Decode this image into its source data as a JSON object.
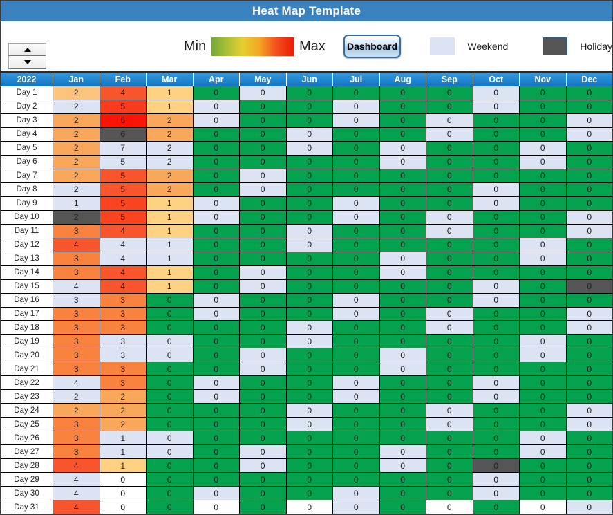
{
  "title": "Heat Map Template",
  "toolbar": {
    "spinner_up": "▲",
    "spinner_down": "▼",
    "min_label": "Min",
    "max_label": "Max",
    "dashboard_label": "Dashboard",
    "weekend_label": "Weekend",
    "holiday_label": "Holiday",
    "gradient_colors": [
      "#74a73a",
      "#e4cf2f",
      "#f5a623",
      "#ee1b05"
    ],
    "weekend_color": "#dce3f2",
    "holiday_color": "#555555",
    "accent_color": "#3a81c0"
  },
  "grid": {
    "corner_label": "2022",
    "months": [
      "Jan",
      "Feb",
      "Mar",
      "Apr",
      "May",
      "Jun",
      "Jul",
      "Aug",
      "Sep",
      "Oct",
      "Nov",
      "Dec"
    ],
    "day_labels": [
      "Day 1",
      "Day 2",
      "Day 3",
      "Day 4",
      "Day 5",
      "Day 6",
      "Day 7",
      "Day 8",
      "Day 9",
      "Day 10",
      "Day 11",
      "Day 12",
      "Day 13",
      "Day 14",
      "Day 15",
      "Day 16",
      "Day 17",
      "Day 18",
      "Day 19",
      "Day 20",
      "Day 21",
      "Day 22",
      "Day 23",
      "Day 24",
      "Day 25",
      "Day 26",
      "Day 27",
      "Day 28",
      "Day 29",
      "Day 30",
      "Day 31"
    ]
  },
  "chart_data": {
    "type": "heatmap",
    "title": "Heat Map Template",
    "xlabel": "",
    "ylabel": "",
    "x_categories": [
      "Jan",
      "Feb",
      "Mar",
      "Apr",
      "May",
      "Jun",
      "Jul",
      "Aug",
      "Sep",
      "Oct",
      "Nov",
      "Dec"
    ],
    "y_categories": [
      "Day 1",
      "Day 2",
      "Day 3",
      "Day 4",
      "Day 5",
      "Day 6",
      "Day 7",
      "Day 8",
      "Day 9",
      "Day 10",
      "Day 11",
      "Day 12",
      "Day 13",
      "Day 14",
      "Day 15",
      "Day 16",
      "Day 17",
      "Day 18",
      "Day 19",
      "Day 20",
      "Day 21",
      "Day 22",
      "Day 23",
      "Day 24",
      "Day 25",
      "Day 26",
      "Day 27",
      "Day 28",
      "Day 29",
      "Day 30",
      "Day 31"
    ],
    "legend": [
      {
        "label": "Min",
        "color": "#74a73a"
      },
      {
        "label": "Max",
        "color": "#ee1b05"
      },
      {
        "label": "Weekend",
        "color": "#dce3f2"
      },
      {
        "label": "Holiday",
        "color": "#555555"
      }
    ],
    "colorscale": [
      "#74a73a",
      "#e4cf2f",
      "#f5a623",
      "#ee1b05"
    ],
    "values": [
      [
        2,
        4,
        1,
        0,
        0,
        0,
        0,
        0,
        0,
        0,
        0,
        0
      ],
      [
        2,
        5,
        1,
        0,
        0,
        0,
        0,
        0,
        0,
        0,
        0,
        0
      ],
      [
        2,
        6,
        2,
        0,
        0,
        0,
        0,
        0,
        0,
        0,
        0,
        0
      ],
      [
        2,
        6,
        2,
        0,
        0,
        0,
        0,
        0,
        0,
        0,
        0,
        0
      ],
      [
        2,
        7,
        2,
        0,
        0,
        0,
        0,
        0,
        0,
        0,
        0,
        0
      ],
      [
        2,
        5,
        2,
        0,
        0,
        0,
        0,
        0,
        0,
        0,
        0,
        0
      ],
      [
        2,
        5,
        2,
        0,
        0,
        0,
        0,
        0,
        0,
        0,
        0,
        0
      ],
      [
        2,
        5,
        2,
        0,
        0,
        0,
        0,
        0,
        0,
        0,
        0,
        0
      ],
      [
        1,
        5,
        1,
        0,
        0,
        0,
        0,
        0,
        0,
        0,
        0,
        0
      ],
      [
        2,
        5,
        1,
        0,
        0,
        0,
        0,
        0,
        0,
        0,
        0,
        0
      ],
      [
        3,
        4,
        1,
        0,
        0,
        0,
        0,
        0,
        0,
        0,
        0,
        0
      ],
      [
        4,
        4,
        1,
        0,
        0,
        0,
        0,
        0,
        0,
        0,
        0,
        0
      ],
      [
        3,
        4,
        1,
        0,
        0,
        0,
        0,
        0,
        0,
        0,
        0,
        0
      ],
      [
        3,
        4,
        1,
        0,
        0,
        0,
        0,
        0,
        0,
        0,
        0,
        0
      ],
      [
        4,
        4,
        1,
        0,
        0,
        0,
        0,
        0,
        0,
        0,
        0,
        0
      ],
      [
        3,
        3,
        0,
        0,
        0,
        0,
        0,
        0,
        0,
        0,
        0,
        0
      ],
      [
        3,
        3,
        0,
        0,
        0,
        0,
        0,
        0,
        0,
        0,
        0,
        0
      ],
      [
        3,
        3,
        0,
        0,
        0,
        0,
        0,
        0,
        0,
        0,
        0,
        0
      ],
      [
        3,
        3,
        0,
        0,
        0,
        0,
        0,
        0,
        0,
        0,
        0,
        0
      ],
      [
        3,
        3,
        0,
        0,
        0,
        0,
        0,
        0,
        0,
        0,
        0,
        0
      ],
      [
        3,
        3,
        0,
        0,
        0,
        0,
        0,
        0,
        0,
        0,
        0,
        0
      ],
      [
        4,
        3,
        0,
        0,
        0,
        0,
        0,
        0,
        0,
        0,
        0,
        0
      ],
      [
        2,
        2,
        0,
        0,
        0,
        0,
        0,
        0,
        0,
        0,
        0,
        0
      ],
      [
        2,
        2,
        0,
        0,
        0,
        0,
        0,
        0,
        0,
        0,
        0,
        0
      ],
      [
        3,
        2,
        0,
        0,
        0,
        0,
        0,
        0,
        0,
        0,
        0,
        0
      ],
      [
        3,
        1,
        0,
        0,
        0,
        0,
        0,
        0,
        0,
        0,
        0,
        0
      ],
      [
        3,
        1,
        0,
        0,
        0,
        0,
        0,
        0,
        0,
        0,
        0,
        0
      ],
      [
        4,
        1,
        0,
        0,
        0,
        0,
        0,
        0,
        0,
        0,
        0,
        0
      ],
      [
        4,
        0,
        0,
        0,
        0,
        0,
        0,
        0,
        0,
        0,
        0,
        0
      ],
      [
        4,
        0,
        0,
        0,
        0,
        0,
        0,
        0,
        0,
        0,
        0,
        0
      ],
      [
        4,
        0,
        0,
        0,
        0,
        0,
        0,
        0,
        0,
        0,
        0,
        0
      ]
    ],
    "cell_fills": [
      [
        "#fbc37c",
        "#f9552d",
        "#ffd182",
        "#04a14e",
        "#dce3f2",
        "#04a14e",
        "#04a14e",
        "#04a14e",
        "#04a14e",
        "#dce3f2",
        "#04a14e",
        "#04a14e"
      ],
      [
        "#dce3f2",
        "#f93b20",
        "#ffd182",
        "#dce3f2",
        "#04a14e",
        "#04a14e",
        "#dce3f2",
        "#04a14e",
        "#04a14e",
        "#dce3f2",
        "#04a14e",
        "#04a14e"
      ],
      [
        "#f9a85b",
        "#fa1406",
        "#f9a85b",
        "#dce3f2",
        "#04a14e",
        "#04a14e",
        "#dce3f2",
        "#04a14e",
        "#dce3f2",
        "#04a14e",
        "#04a14e",
        "#dce3f2"
      ],
      [
        "#f9a85b",
        "#555555",
        "#f9a85b",
        "#04a14e",
        "#04a14e",
        "#dce3f2",
        "#04a14e",
        "#04a14e",
        "#dce3f2",
        "#04a14e",
        "#04a14e",
        "#dce3f2"
      ],
      [
        "#f9a85b",
        "#dce3f2",
        "#dce3f2",
        "#04a14e",
        "#04a14e",
        "#dce3f2",
        "#04a14e",
        "#dce3f2",
        "#04a14e",
        "#04a14e",
        "#dce3f2",
        "#04a14e"
      ],
      [
        "#f9a85b",
        "#dce3f2",
        "#dce3f2",
        "#04a14e",
        "#04a14e",
        "#04a14e",
        "#04a14e",
        "#dce3f2",
        "#04a14e",
        "#04a14e",
        "#dce3f2",
        "#04a14e"
      ],
      [
        "#f9a85b",
        "#f9552d",
        "#f9a85b",
        "#04a14e",
        "#dce3f2",
        "#04a14e",
        "#04a14e",
        "#04a14e",
        "#04a14e",
        "#04a14e",
        "#04a14e",
        "#04a14e"
      ],
      [
        "#dce3f2",
        "#f9552d",
        "#f9a85b",
        "#04a14e",
        "#dce3f2",
        "#04a14e",
        "#04a14e",
        "#04a14e",
        "#04a14e",
        "#dce3f2",
        "#04a14e",
        "#04a14e"
      ],
      [
        "#dce3f2",
        "#f9441f",
        "#ffd182",
        "#dce3f2",
        "#04a14e",
        "#04a14e",
        "#dce3f2",
        "#04a14e",
        "#04a14e",
        "#dce3f2",
        "#04a14e",
        "#04a14e"
      ],
      [
        "#555555",
        "#f9441f",
        "#ffd182",
        "#dce3f2",
        "#04a14e",
        "#04a14e",
        "#dce3f2",
        "#04a14e",
        "#dce3f2",
        "#04a14e",
        "#04a14e",
        "#dce3f2"
      ],
      [
        "#f9823f",
        "#f9552d",
        "#ffd182",
        "#04a14e",
        "#04a14e",
        "#dce3f2",
        "#04a14e",
        "#04a14e",
        "#dce3f2",
        "#04a14e",
        "#04a14e",
        "#dce3f2"
      ],
      [
        "#f9552d",
        "#dce3f2",
        "#dce3f2",
        "#04a14e",
        "#04a14e",
        "#dce3f2",
        "#04a14e",
        "#04a14e",
        "#04a14e",
        "#04a14e",
        "#dce3f2",
        "#04a14e"
      ],
      [
        "#f9823f",
        "#dce3f2",
        "#dce3f2",
        "#04a14e",
        "#04a14e",
        "#04a14e",
        "#04a14e",
        "#dce3f2",
        "#04a14e",
        "#04a14e",
        "#dce3f2",
        "#04a14e"
      ],
      [
        "#f9823f",
        "#f9552d",
        "#ffd182",
        "#04a14e",
        "#dce3f2",
        "#04a14e",
        "#04a14e",
        "#dce3f2",
        "#04a14e",
        "#04a14e",
        "#04a14e",
        "#04a14e"
      ],
      [
        "#dce3f2",
        "#f9552d",
        "#ffd182",
        "#04a14e",
        "#dce3f2",
        "#04a14e",
        "#04a14e",
        "#04a14e",
        "#04a14e",
        "#dce3f2",
        "#04a14e",
        "#555555"
      ],
      [
        "#dce3f2",
        "#f9823f",
        "#04a14e",
        "#dce3f2",
        "#04a14e",
        "#04a14e",
        "#dce3f2",
        "#04a14e",
        "#04a14e",
        "#dce3f2",
        "#04a14e",
        "#04a14e"
      ],
      [
        "#f9823f",
        "#f9823f",
        "#04a14e",
        "#dce3f2",
        "#04a14e",
        "#04a14e",
        "#dce3f2",
        "#04a14e",
        "#dce3f2",
        "#04a14e",
        "#04a14e",
        "#dce3f2"
      ],
      [
        "#f9823f",
        "#f9823f",
        "#04a14e",
        "#04a14e",
        "#04a14e",
        "#dce3f2",
        "#04a14e",
        "#04a14e",
        "#dce3f2",
        "#04a14e",
        "#04a14e",
        "#dce3f2"
      ],
      [
        "#f9823f",
        "#dce3f2",
        "#dce3f2",
        "#04a14e",
        "#04a14e",
        "#dce3f2",
        "#04a14e",
        "#04a14e",
        "#04a14e",
        "#04a14e",
        "#dce3f2",
        "#04a14e"
      ],
      [
        "#f9823f",
        "#dce3f2",
        "#dce3f2",
        "#04a14e",
        "#dce3f2",
        "#04a14e",
        "#04a14e",
        "#dce3f2",
        "#04a14e",
        "#04a14e",
        "#dce3f2",
        "#04a14e"
      ],
      [
        "#f9823f",
        "#f9823f",
        "#04a14e",
        "#04a14e",
        "#dce3f2",
        "#04a14e",
        "#04a14e",
        "#dce3f2",
        "#04a14e",
        "#04a14e",
        "#04a14e",
        "#04a14e"
      ],
      [
        "#dce3f2",
        "#f9823f",
        "#04a14e",
        "#dce3f2",
        "#04a14e",
        "#04a14e",
        "#dce3f2",
        "#04a14e",
        "#04a14e",
        "#dce3f2",
        "#04a14e",
        "#04a14e"
      ],
      [
        "#dce3f2",
        "#f9a85b",
        "#04a14e",
        "#dce3f2",
        "#04a14e",
        "#04a14e",
        "#dce3f2",
        "#04a14e",
        "#04a14e",
        "#dce3f2",
        "#04a14e",
        "#04a14e"
      ],
      [
        "#f9a85b",
        "#f9a85b",
        "#04a14e",
        "#04a14e",
        "#04a14e",
        "#dce3f2",
        "#04a14e",
        "#04a14e",
        "#dce3f2",
        "#04a14e",
        "#04a14e",
        "#dce3f2"
      ],
      [
        "#f9823f",
        "#f9a85b",
        "#04a14e",
        "#04a14e",
        "#04a14e",
        "#dce3f2",
        "#04a14e",
        "#04a14e",
        "#dce3f2",
        "#04a14e",
        "#04a14e",
        "#dce3f2"
      ],
      [
        "#f9823f",
        "#dce3f2",
        "#dce3f2",
        "#04a14e",
        "#04a14e",
        "#04a14e",
        "#04a14e",
        "#04a14e",
        "#04a14e",
        "#04a14e",
        "#dce3f2",
        "#04a14e"
      ],
      [
        "#f9823f",
        "#dce3f2",
        "#dce3f2",
        "#04a14e",
        "#dce3f2",
        "#04a14e",
        "#04a14e",
        "#dce3f2",
        "#04a14e",
        "#04a14e",
        "#dce3f2",
        "#04a14e"
      ],
      [
        "#f9552d",
        "#ffd182",
        "#04a14e",
        "#04a14e",
        "#dce3f2",
        "#04a14e",
        "#04a14e",
        "#dce3f2",
        "#04a14e",
        "#555555",
        "#04a14e",
        "#04a14e"
      ],
      [
        "#dce3f2",
        "#ffffff",
        "#04a14e",
        "#04a14e",
        "#04a14e",
        "#04a14e",
        "#04a14e",
        "#04a14e",
        "#04a14e",
        "#dce3f2",
        "#04a14e",
        "#04a14e"
      ],
      [
        "#dce3f2",
        "#ffffff",
        "#04a14e",
        "#dce3f2",
        "#04a14e",
        "#04a14e",
        "#dce3f2",
        "#04a14e",
        "#04a14e",
        "#dce3f2",
        "#04a14e",
        "#04a14e"
      ],
      [
        "#f9552d",
        "#ffffff",
        "#04a14e",
        "#ffffff",
        "#04a14e",
        "#ffffff",
        "#dce3f2",
        "#04a14e",
        "#ffffff",
        "#04a14e",
        "#ffffff",
        "#dce3f2"
      ]
    ]
  }
}
